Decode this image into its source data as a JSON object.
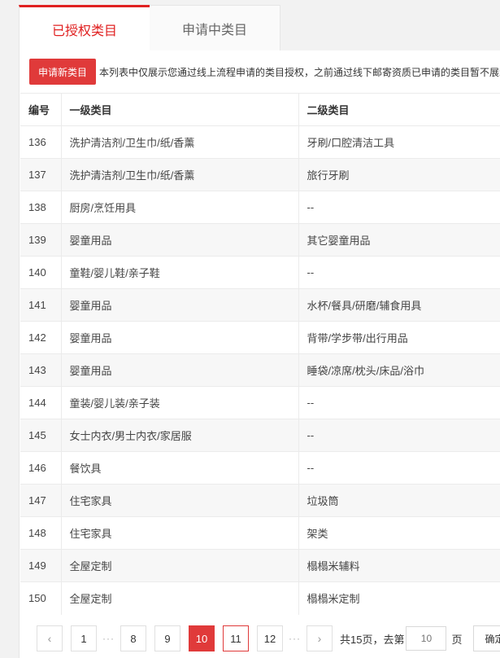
{
  "tabs": {
    "authorized": "已授权类目",
    "applying": "申请中类目"
  },
  "toolbar": {
    "apply_label": "申请新类目",
    "notice": "本列表中仅展示您通过线上流程申请的类目授权，之前通过线下邮寄资质已申请的类目暂不展示"
  },
  "table": {
    "headers": [
      "编号",
      "一级类目",
      "二级类目"
    ],
    "rows": [
      [
        "136",
        "洗护清洁剂/卫生巾/纸/香薰",
        "牙刷/口腔清洁工具"
      ],
      [
        "137",
        "洗护清洁剂/卫生巾/纸/香薰",
        "旅行牙刷"
      ],
      [
        "138",
        "厨房/烹饪用具",
        "--"
      ],
      [
        "139",
        "婴童用品",
        "其它婴童用品"
      ],
      [
        "140",
        "童鞋/婴儿鞋/亲子鞋",
        "--"
      ],
      [
        "141",
        "婴童用品",
        "水杯/餐具/研磨/辅食用具"
      ],
      [
        "142",
        "婴童用品",
        "背带/学步带/出行用品"
      ],
      [
        "143",
        "婴童用品",
        "睡袋/凉席/枕头/床品/浴巾"
      ],
      [
        "144",
        "童装/婴儿装/亲子装",
        "--"
      ],
      [
        "145",
        "女士内衣/男士内衣/家居服",
        "--"
      ],
      [
        "146",
        "餐饮具",
        "--"
      ],
      [
        "147",
        "住宅家具",
        "垃圾筒"
      ],
      [
        "148",
        "住宅家具",
        "架类"
      ],
      [
        "149",
        "全屋定制",
        "榻榻米辅料"
      ],
      [
        "150",
        "全屋定制",
        "榻榻米定制"
      ]
    ]
  },
  "pagination": {
    "prev": "‹",
    "next": "›",
    "first": "1",
    "ellipsis": "···",
    "pages": [
      "8",
      "9",
      "10",
      "11",
      "12"
    ],
    "current": "10",
    "total_text": "共15页，去第",
    "goto_placeholder": "10",
    "page_suffix": "页",
    "confirm": "确定"
  }
}
